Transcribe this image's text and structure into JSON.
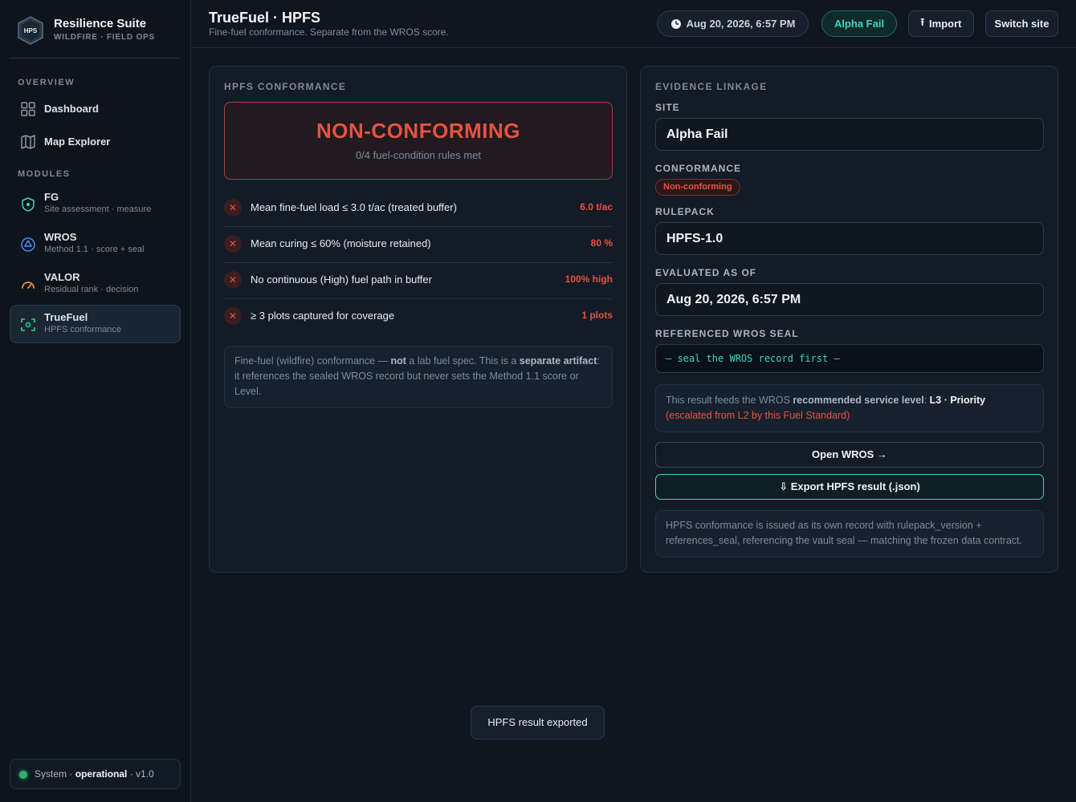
{
  "brand": {
    "logo_text": "HPS",
    "title": "Resilience Suite",
    "subtitle": "WILDFIRE · FIELD OPS"
  },
  "sidebar": {
    "overview_label": "OVERVIEW",
    "modules_label": "MODULES",
    "overview_items": [
      {
        "label": "Dashboard",
        "icon": "grid-icon"
      },
      {
        "label": "Map Explorer",
        "icon": "map-icon"
      }
    ],
    "module_items": [
      {
        "label": "FG",
        "sub": "Site assessment · measure",
        "icon": "shield-icon",
        "color": "#3fd4c0"
      },
      {
        "label": "WROS",
        "sub": "Method 1.1 · score + seal",
        "icon": "seal-icon",
        "color": "#4f8ff7"
      },
      {
        "label": "VALOR",
        "sub": "Residual rank · decision",
        "icon": "gauge-icon",
        "color": "#f08c2e"
      },
      {
        "label": "TrueFuel",
        "sub": "HPFS conformance",
        "icon": "scan-icon",
        "color": "#2fd28a",
        "active": true
      }
    ],
    "status": {
      "prefix": "System ·",
      "state": "operational",
      "version": "· v1.0"
    }
  },
  "header": {
    "title": "TrueFuel · HPFS",
    "subtitle": "Fine-fuel conformance. Separate from the WROS score.",
    "datetime": "Aug 20, 2026, 6:57 PM",
    "site": "Alpha Fail",
    "import_label": "Import",
    "switch_label": "Switch site"
  },
  "conformance": {
    "heading": "HPFS CONFORMANCE",
    "verdict": "NON-CONFORMING",
    "verdict_sub": "0/4 fuel-condition rules met",
    "rules": [
      {
        "mark": "✕",
        "text": "Mean fine-fuel load ≤ 3.0 t/ac (treated buffer)",
        "value": "6.0 t/ac"
      },
      {
        "mark": "✕",
        "text": "Mean curing ≤ 60% (moisture retained)",
        "value": "80 %"
      },
      {
        "mark": "✕",
        "text": "No continuous (High) fuel path in buffer",
        "value": "100% high"
      },
      {
        "mark": "✕",
        "text": "≥ 3 plots captured for coverage",
        "value": "1 plots"
      }
    ],
    "note": {
      "p1": "Fine-fuel (wildfire) conformance — ",
      "b1": "not",
      "p2": " a lab fuel spec. This is a ",
      "b2": "separate artifact",
      "p3": ": it references the sealed WROS record but never sets the Method 1.1 score or Level."
    }
  },
  "evidence": {
    "heading": "EVIDENCE LINKAGE",
    "site_label": "SITE",
    "site_value": "Alpha Fail",
    "conformance_label": "CONFORMANCE",
    "conformance_badge": "Non-conforming",
    "rulepack_label": "RULEPACK",
    "rulepack_value": "HPFS-1.0",
    "evaluated_label": "EVALUATED AS OF",
    "evaluated_value": "Aug 20, 2026, 6:57 PM",
    "seal_label": "REFERENCED WROS SEAL",
    "seal_value": "— seal the WROS record first —",
    "feed": {
      "p1": "This result feeds the WROS ",
      "b1": "recommended service level",
      "p2": ": ",
      "b2": "L3 · Priority",
      "escalated": "(escalated from L2 by this Fuel Standard)"
    },
    "open_label": "Open WROS →",
    "export_label": "⇩ Export HPFS result (.json)",
    "contract_note": "HPFS conformance is issued as its own record with rulepack_version + references_seal, referencing the vault seal — matching the frozen data contract."
  },
  "toast": "HPFS result exported",
  "colors": {
    "accent": "#3fd4c0",
    "danger": "#e5533f",
    "ok": "#2fb36b"
  }
}
